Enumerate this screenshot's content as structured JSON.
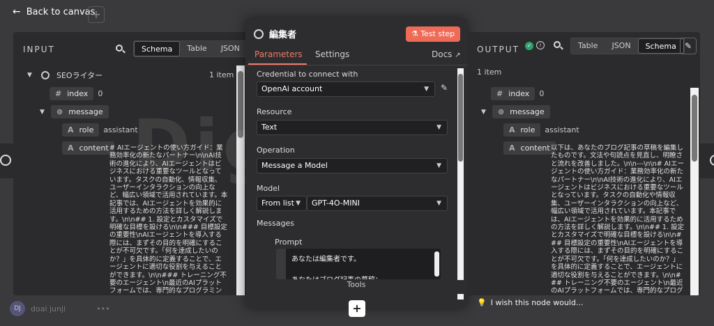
{
  "topbar": {
    "back_label": "Back to canvas",
    "plus": "+"
  },
  "input_panel": {
    "title": "INPUT",
    "views": [
      "Schema",
      "Table",
      "JSON"
    ],
    "active_view": "Schema",
    "node_name": "SEOライター",
    "item_count": "1 item",
    "fields": {
      "index_label": "index",
      "index_value": "0",
      "message_label": "message",
      "role_label": "role",
      "role_value": "assistant",
      "content_label": "content",
      "content_value": "# AIエージェントの使い方ガイド：業務効率化の新たなパートナー\\n\\nAI技術の進化により、AIエージェントはビジネスにおける重要なツールとなっています。タスクの自動化、情報収集、ユーザーインタラクションの向上など、幅広い領域で活用されています。本記事では、AIエージェントを効果的に活用するための方法を詳しく解説します。\\n\\n## 1. 設定とカスタマイズで明確な目標を設ける\\n\\n### 目標設定の重要性\\nAIエージェントを導入する際には、まずその目的を明確にすることが不可欠です。「何を達成したいのか？」を具体的に定義することで、エージェントに適切な役割を与えることができます。\\n\\n### トレーニング不要のエージェント\\n最近のAIプラットフォームでは、専門的なプログラミング知識がなくても直感的にエージェントを設定できます。これにより、スピーディに導入できるため、ビジネスのスピード感を保ちつつ新しい"
    }
  },
  "modal": {
    "title": "編集者",
    "test_button": "Test step",
    "tabs": [
      "Parameters",
      "Settings"
    ],
    "docs": "Docs",
    "credential_label": "Credential to connect with",
    "credential_value": "OpenAi account",
    "resource_label": "Resource",
    "resource_value": "Text",
    "operation_label": "Operation",
    "operation_value": "Message a Model",
    "model_label": "Model",
    "model_mode": "From list",
    "model_value": "GPT-4O-MINI",
    "messages_label": "Messages",
    "prompt_label": "Prompt",
    "prompt_line1": "あなたは編集者です。",
    "prompt_line2": "あなたはブログ記事の草稿：",
    "tools_label": "Tools"
  },
  "output_panel": {
    "title": "OUTPUT",
    "views": [
      "Table",
      "JSON",
      "Schema"
    ],
    "active_view": "Schema",
    "item_count": "1 item",
    "fields": {
      "index_label": "index",
      "index_value": "0",
      "message_label": "message",
      "role_label": "role",
      "role_value": "assistant",
      "content_label": "content",
      "content_value": "以下は、あなたのブログ記事の草稿を編集したものです。文法や句読点を見直し、明瞭さと流れを改善しました。\\n\\n---\\n\\n# AIエージェントの使い方ガイド：業務効率化の新たなパートナー\\n\\nAI技術の進化により、AIエージェントはビジネスにおける重要なツールとなっています。タスクの自動化や情報収集、ユーザーインタラクションの向上など、幅広い領域で活用されています。本記事では、AIエージェントを効果的に活用するための方法を詳しく解説します。\\n\\n## 1. 設定とカスタマイズで明確な目標を設ける\\n\\n### 目標設定の重要性\\nAIエージェントを導入する際には、まずその目的を明確にすることが不可欠です。「何を達成したいのか？」を具体的に定義することで、エージェントに適切な役割を与えることができます。\\n\\n### トレーニング不要のエージェント\\n最近のAIプラットフォームでは、専門的なプログラミング知識がなくても直感的にエージェントを設定できます。これにより、スピーディに導入できるため、ビジネス"
    }
  },
  "footer": {
    "user_initials": "DJ",
    "user_name": "doai junji",
    "wish": "I wish this node would..."
  },
  "watermark": "Digicra",
  "colors": {
    "accent": "#ef7a66",
    "test_button": "#ef6a57",
    "success": "#2fa36b"
  }
}
